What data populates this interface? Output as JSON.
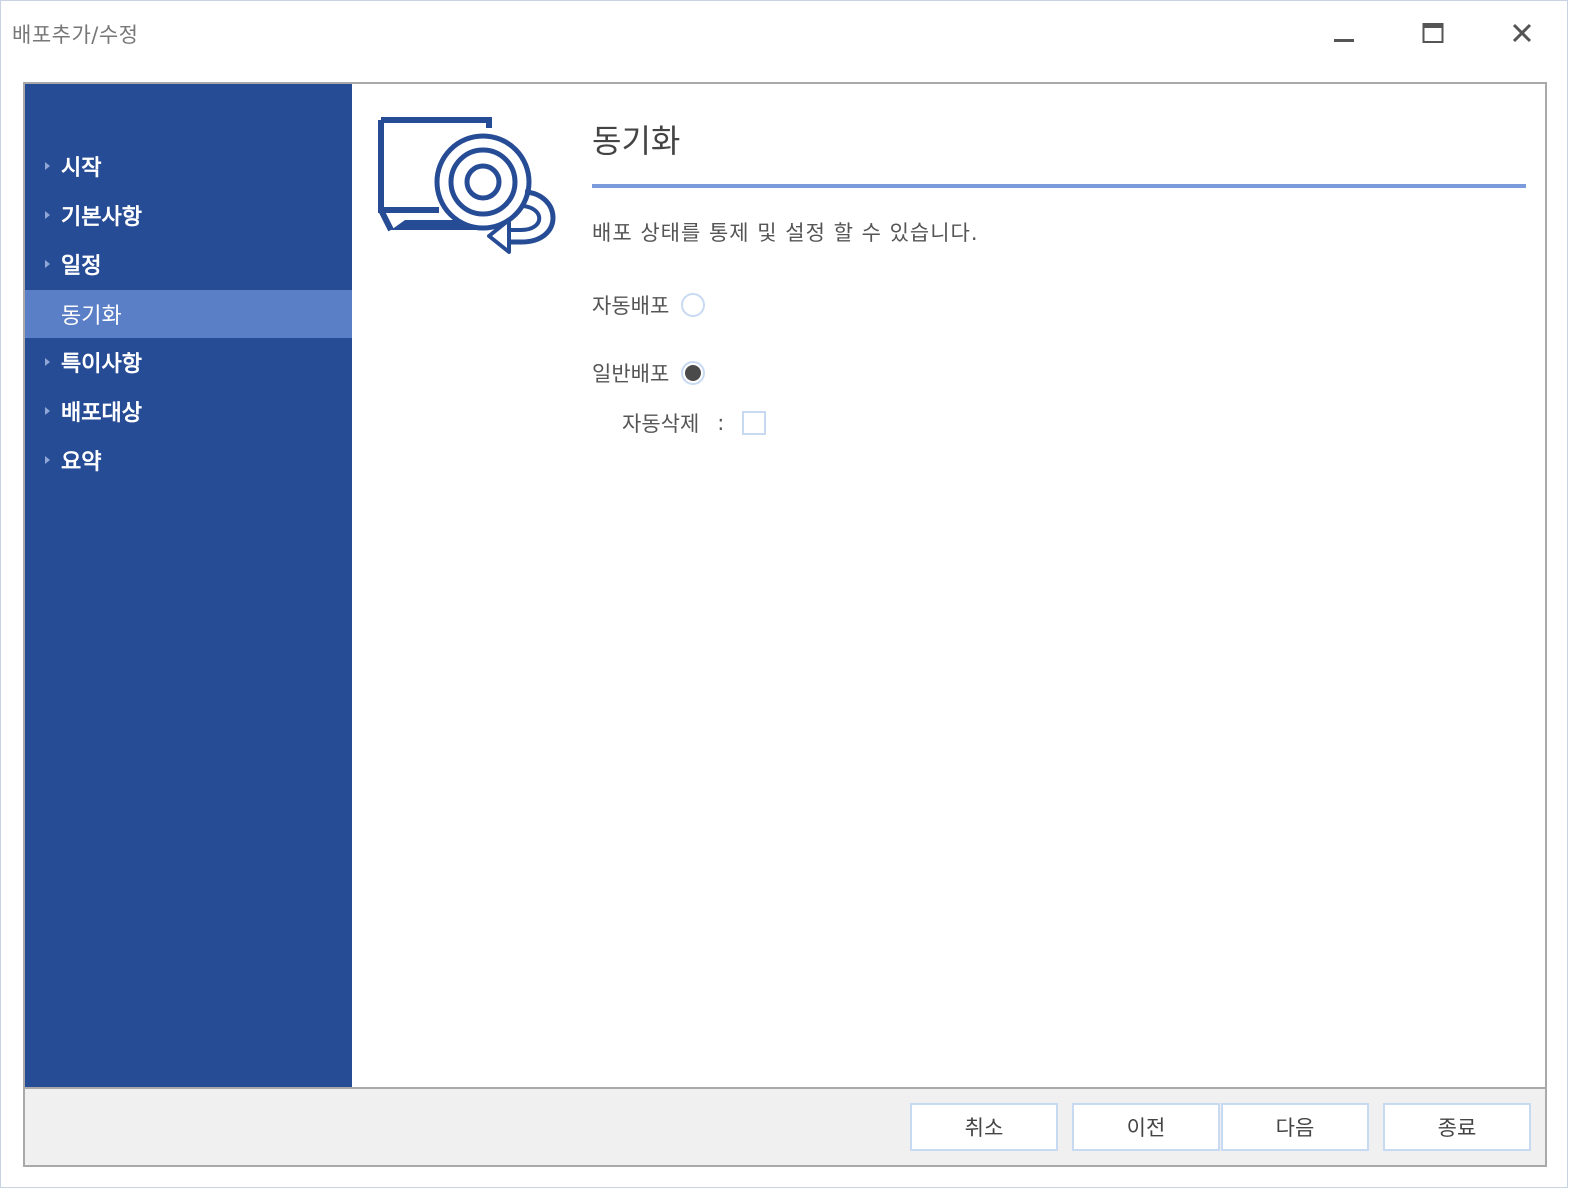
{
  "window": {
    "title": "배포추가/수정",
    "controls": {
      "minimize_icon": "minimize-icon",
      "maximize_icon": "maximize-icon",
      "close_icon": "close-icon"
    }
  },
  "sidebar": {
    "background": "#274c96",
    "active_background": "#5b7fc7",
    "items": [
      {
        "label": "시작",
        "active": false
      },
      {
        "label": "기본사항",
        "active": false
      },
      {
        "label": "일정",
        "active": false
      },
      {
        "label": "동기화",
        "active": true
      },
      {
        "label": "특이사항",
        "active": false
      },
      {
        "label": "배포대상",
        "active": false
      },
      {
        "label": "요약",
        "active": false
      }
    ]
  },
  "main": {
    "icon": "monitor-disc-sync-icon",
    "title": "동기화",
    "description": "배포 상태를 통제 및 설정 할 수 있습니다.",
    "options": {
      "auto_deploy": {
        "label": "자동배포",
        "selected": false
      },
      "normal_deploy": {
        "label": "일반배포",
        "selected": true
      },
      "auto_delete": {
        "label": "자동삭제",
        "separator": ":",
        "checked": false
      }
    }
  },
  "footer": {
    "buttons": {
      "cancel": "취소",
      "previous": "이전",
      "next": "다음",
      "finish": "종료"
    }
  }
}
